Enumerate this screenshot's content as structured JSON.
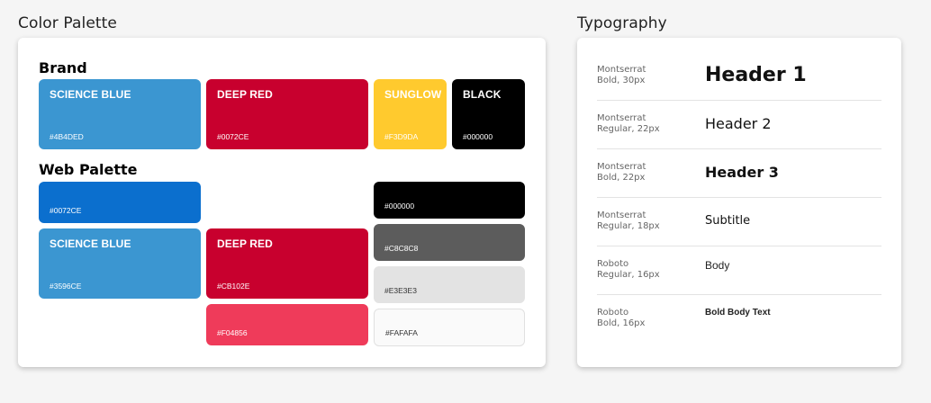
{
  "sections": {
    "color_title": "Color Palette",
    "typography_title": "Typography"
  },
  "brand": {
    "title": "Brand",
    "swatches": [
      {
        "name": "SCIENCE BLUE",
        "hex": "#4B4DED",
        "color": "#3b96d1"
      },
      {
        "name": "DEEP RED",
        "hex": "#0072CE",
        "color": "#c8002e"
      },
      {
        "name": "SUNGLOW",
        "hex": "#F3D9DA",
        "color": "#ffca2e"
      },
      {
        "name": "BLACK",
        "hex": "#000000",
        "color": "#000000"
      }
    ]
  },
  "web": {
    "title": "Web Palette",
    "swatches": [
      {
        "name": "",
        "hex": "#0072CE",
        "color": "#0b6fce"
      },
      {
        "name": "SCIENCE BLUE",
        "hex": "#3596CE",
        "color": "#3b96d1"
      },
      {
        "name": "DEEP RED",
        "hex": "#CB102E",
        "color": "#c8002e"
      },
      {
        "name": "",
        "hex": "#F04856",
        "color": "#ef3b5a"
      },
      {
        "name": "",
        "hex": "#000000",
        "color": "#000000"
      },
      {
        "name": "",
        "hex": "#C8C8C8",
        "color": "#5c5c5c"
      },
      {
        "name": "",
        "hex": "#E3E3E3",
        "color": "#e3e3e3"
      },
      {
        "name": "",
        "hex": "#FAFAFA",
        "color": "#fafafa"
      }
    ]
  },
  "typography": [
    {
      "font": "Montserrat",
      "spec": "Bold, 30px",
      "sample": "Header 1"
    },
    {
      "font": "Montserrat",
      "spec": "Regular, 22px",
      "sample": "Header 2"
    },
    {
      "font": "Montserrat",
      "spec": "Bold, 22px",
      "sample": "Header 3"
    },
    {
      "font": "Montserrat",
      "spec": "Regular, 18px",
      "sample": "Subtitle"
    },
    {
      "font": "Roboto",
      "spec": "Regular, 16px",
      "sample": "Body"
    },
    {
      "font": "Roboto",
      "spec": "Bold, 16px",
      "sample": "Bold Body Text"
    }
  ]
}
